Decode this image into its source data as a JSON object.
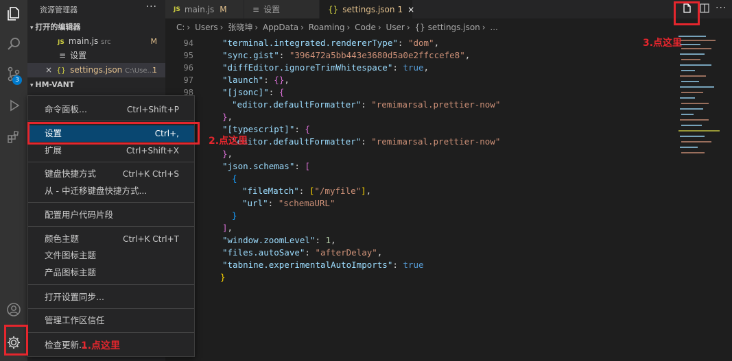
{
  "sidebar": {
    "title": "资源管理器",
    "more": "···",
    "open_editors_label": "打开的编辑器",
    "open_editors": [
      {
        "badge": "JS",
        "name": "main.js",
        "path": "src",
        "status": "M"
      },
      {
        "badge": "≡",
        "name": "设置",
        "path": "",
        "status": ""
      },
      {
        "badge": "{}",
        "name": "settings.json",
        "path": "C:\\Use...",
        "status": "1",
        "close": "×"
      }
    ],
    "folder_label": "HM-VANT"
  },
  "tabs": [
    {
      "icon": "JS",
      "label": "main.js",
      "status": "M"
    },
    {
      "icon": "≡",
      "label": "设置",
      "status": ""
    },
    {
      "icon": "{}",
      "label": "settings.json",
      "status": "1",
      "close": "×"
    }
  ],
  "breadcrumb": [
    "C:",
    "Users",
    "张晓坤",
    "AppData",
    "Roaming",
    "Code",
    "User",
    "{} settings.json",
    "..."
  ],
  "editor": {
    "lines": [
      {
        "num": "94"
      },
      {
        "num": "95"
      },
      {
        "num": "96"
      },
      {
        "num": "97"
      },
      {
        "num": "98"
      }
    ],
    "code": {
      "l0_key": "\"terminal.integrated.rendererType\"",
      "l0_val": "\"dom\"",
      "l1_key": "\"sync.gist\"",
      "l1_val": "\"396472a5bb443e3680d5a0e2ffccefe8\"",
      "l2_key": "\"diffEditor.ignoreTrimWhitespace\"",
      "l2_val": "true",
      "l3_key": "\"launch\"",
      "l3_val": "{}",
      "l4_key": "\"[jsonc]\"",
      "l5_key": "\"editor.defaultFormatter\"",
      "l5_val": "\"remimarsal.prettier-now\"",
      "l7_key": "\"[typescript]\"",
      "l8_key": "\"editor.defaultFormatter\"",
      "l8_val": "\"remimarsal.prettier-now\"",
      "l10_key": "\"json.schemas\"",
      "l12_key": "\"fileMatch\"",
      "l12_val": "\"/myfile\"",
      "l13_key": "\"url\"",
      "l13_val": "\"schemaURL\"",
      "l16_key": "\"window.zoomLevel\"",
      "l16_val": "1",
      "l17_key": "\"files.autoSave\"",
      "l17_val": "\"afterDelay\"",
      "l18_key": "\"tabnine.experimentalAutoImports\"",
      "l18_val": "true"
    }
  },
  "menu": {
    "items": [
      {
        "label": "命令面板...",
        "shortcut": "Ctrl+Shift+P"
      },
      {
        "label": "设置",
        "shortcut": "Ctrl+,"
      },
      {
        "label": "扩展",
        "shortcut": "Ctrl+Shift+X"
      },
      {
        "label": "键盘快捷方式",
        "shortcut": "Ctrl+K Ctrl+S"
      },
      {
        "label": "从 - 中迁移键盘快捷方式...",
        "shortcut": ""
      },
      {
        "label": "配置用户代码片段",
        "shortcut": ""
      },
      {
        "label": "颜色主题",
        "shortcut": "Ctrl+K Ctrl+T"
      },
      {
        "label": "文件图标主题",
        "shortcut": ""
      },
      {
        "label": "产品图标主题",
        "shortcut": ""
      },
      {
        "label": "打开设置同步...",
        "shortcut": ""
      },
      {
        "label": "管理工作区信任",
        "shortcut": ""
      },
      {
        "label": "检查更新...",
        "shortcut": ""
      }
    ]
  },
  "activity": {
    "scm_badge": "3"
  },
  "annotations": {
    "step1": "1.点这里",
    "step2": "2.点这里",
    "step3": "3.点这里"
  },
  "colors": {
    "accent": "#094771",
    "annotation": "#e5262d"
  }
}
